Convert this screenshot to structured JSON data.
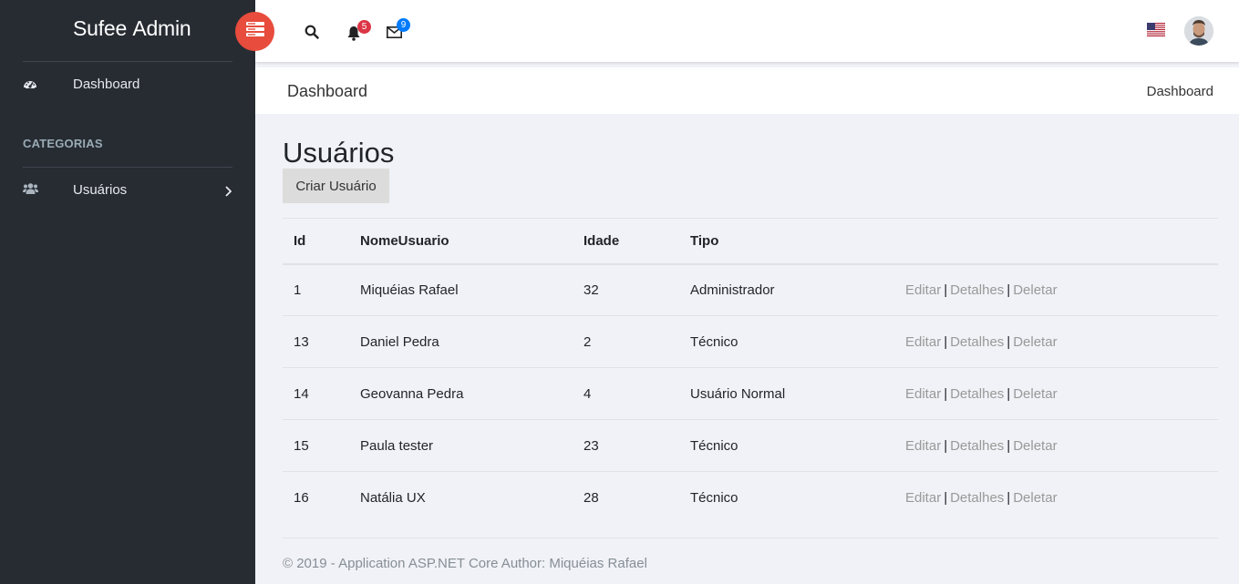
{
  "brand": {
    "light": "Sufee",
    "strong": "Admin"
  },
  "sidebar": {
    "items": [
      {
        "label": "Dashboard",
        "icon": "dashboard-icon"
      },
      {
        "label": "Usuários",
        "icon": "users-icon"
      }
    ],
    "section_title": "CATEGORIAS"
  },
  "header": {
    "notifications_count": "5",
    "messages_count": "9"
  },
  "breadcrumb": {
    "title": "Dashboard",
    "crumb": "Dashboard"
  },
  "main": {
    "heading": "Usuários",
    "create_button": "Criar Usuário",
    "table": {
      "headers": [
        "Id",
        "NomeUsuario",
        "Idade",
        "Tipo"
      ],
      "rows": [
        {
          "id": "1",
          "nome": "Miquéias Rafael",
          "idade": "32",
          "tipo": "Administrador"
        },
        {
          "id": "13",
          "nome": "Daniel Pedra",
          "idade": "2",
          "tipo": "Técnico"
        },
        {
          "id": "14",
          "nome": "Geovanna Pedra",
          "idade": "4",
          "tipo": "Usuário Normal"
        },
        {
          "id": "15",
          "nome": "Paula tester",
          "idade": "23",
          "tipo": "Técnico"
        },
        {
          "id": "16",
          "nome": "Natália UX",
          "idade": "28",
          "tipo": "Técnico"
        }
      ],
      "actions": {
        "edit": "Editar",
        "details": "Detalhes",
        "delete": "Deletar",
        "separator": "|"
      }
    }
  },
  "footer": {
    "text": "© 2019 - Application ASP.NET Core Author: Miquéias Rafael"
  },
  "colors": {
    "sidebar_bg": "#272c33",
    "toggle": "#e74c3c",
    "content_bg": "#f1f2f7",
    "badge_red": "#dc3545",
    "badge_blue": "#007bff"
  }
}
